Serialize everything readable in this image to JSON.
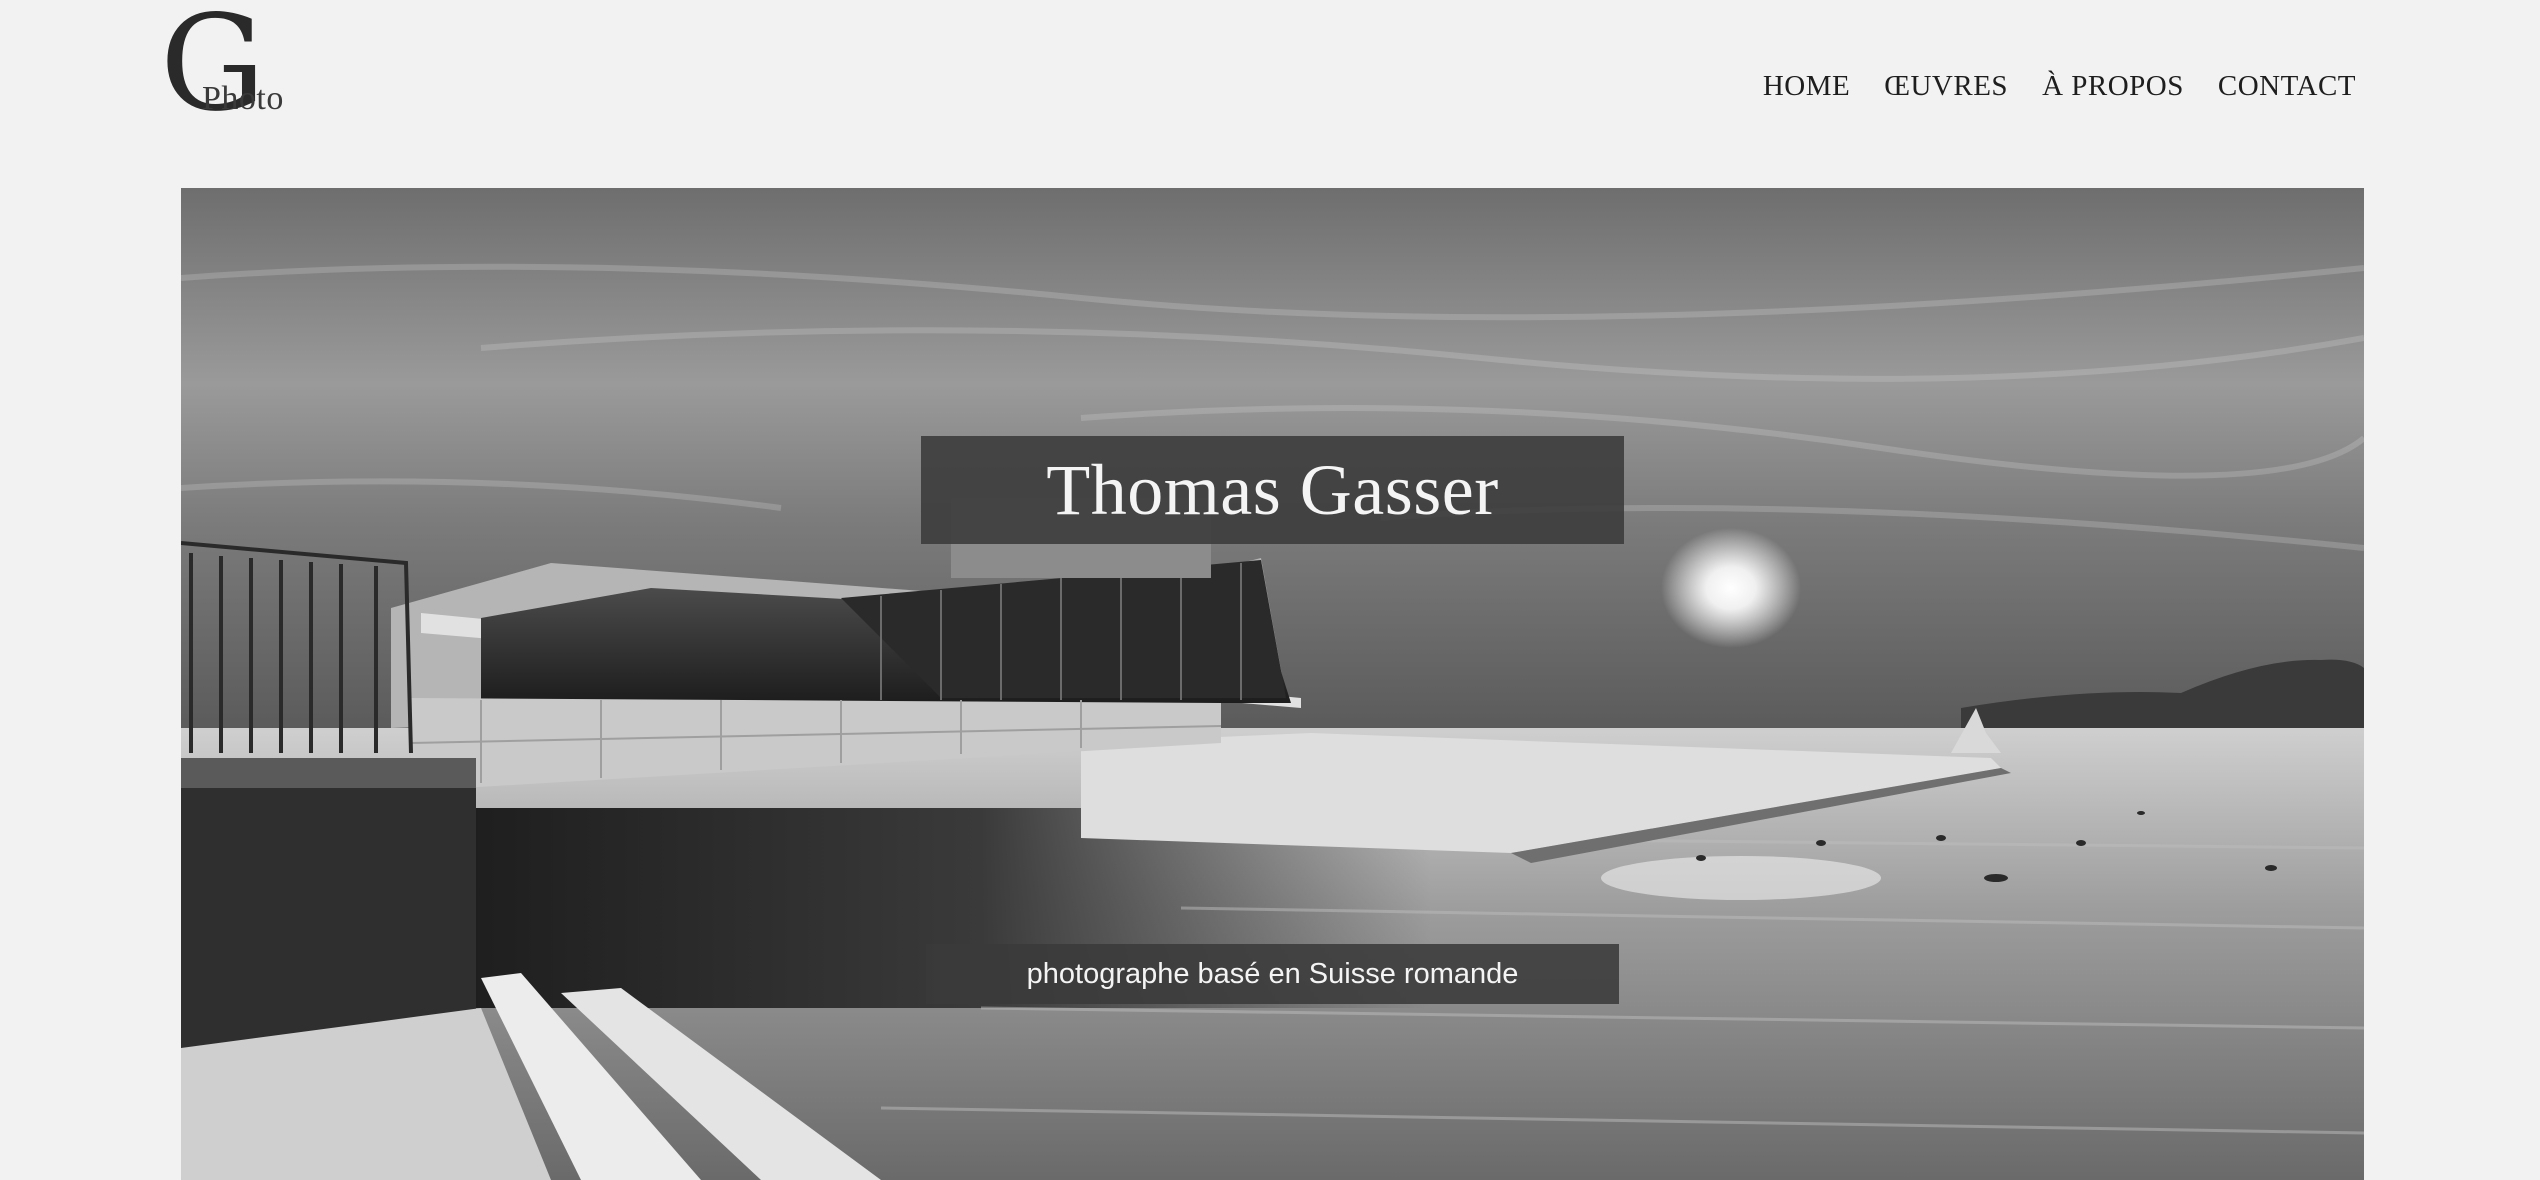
{
  "logo": {
    "letter": "G",
    "word": "Photo"
  },
  "nav": {
    "items": [
      {
        "label": "HOME"
      },
      {
        "label": "ŒUVRES"
      },
      {
        "label": "À PROPOS"
      },
      {
        "label": "CONTACT"
      }
    ]
  },
  "hero": {
    "title": "Thomas Gasser",
    "subtitle": "photographe basé en Suisse romande",
    "image_style": "monochrome"
  }
}
